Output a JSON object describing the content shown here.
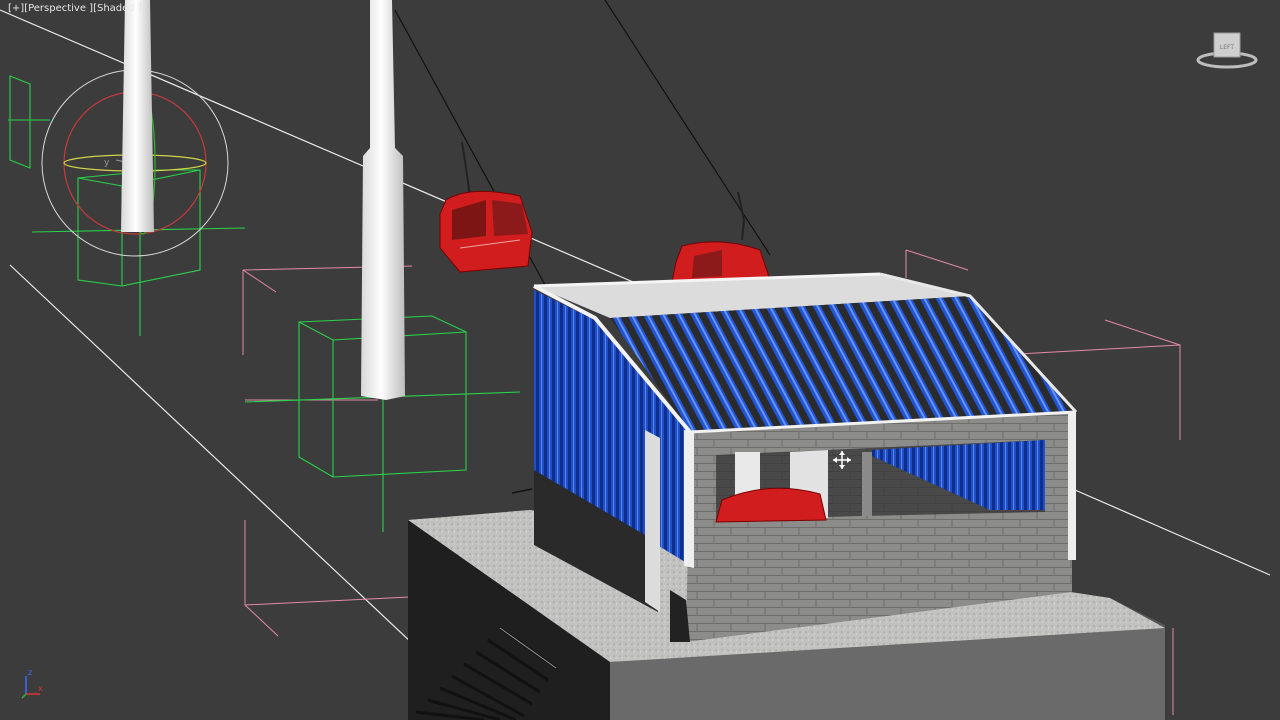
{
  "viewport": {
    "label_menu": "[+]",
    "label_view": "[Perspective ]",
    "label_shading": "[Shaded ]"
  },
  "viewcube": {
    "face_label": "LEFT"
  },
  "axes": {
    "x": "x",
    "y": "y",
    "z": "z"
  },
  "gizmo_axes": {
    "z": "z",
    "y": "y",
    "x": "x"
  }
}
